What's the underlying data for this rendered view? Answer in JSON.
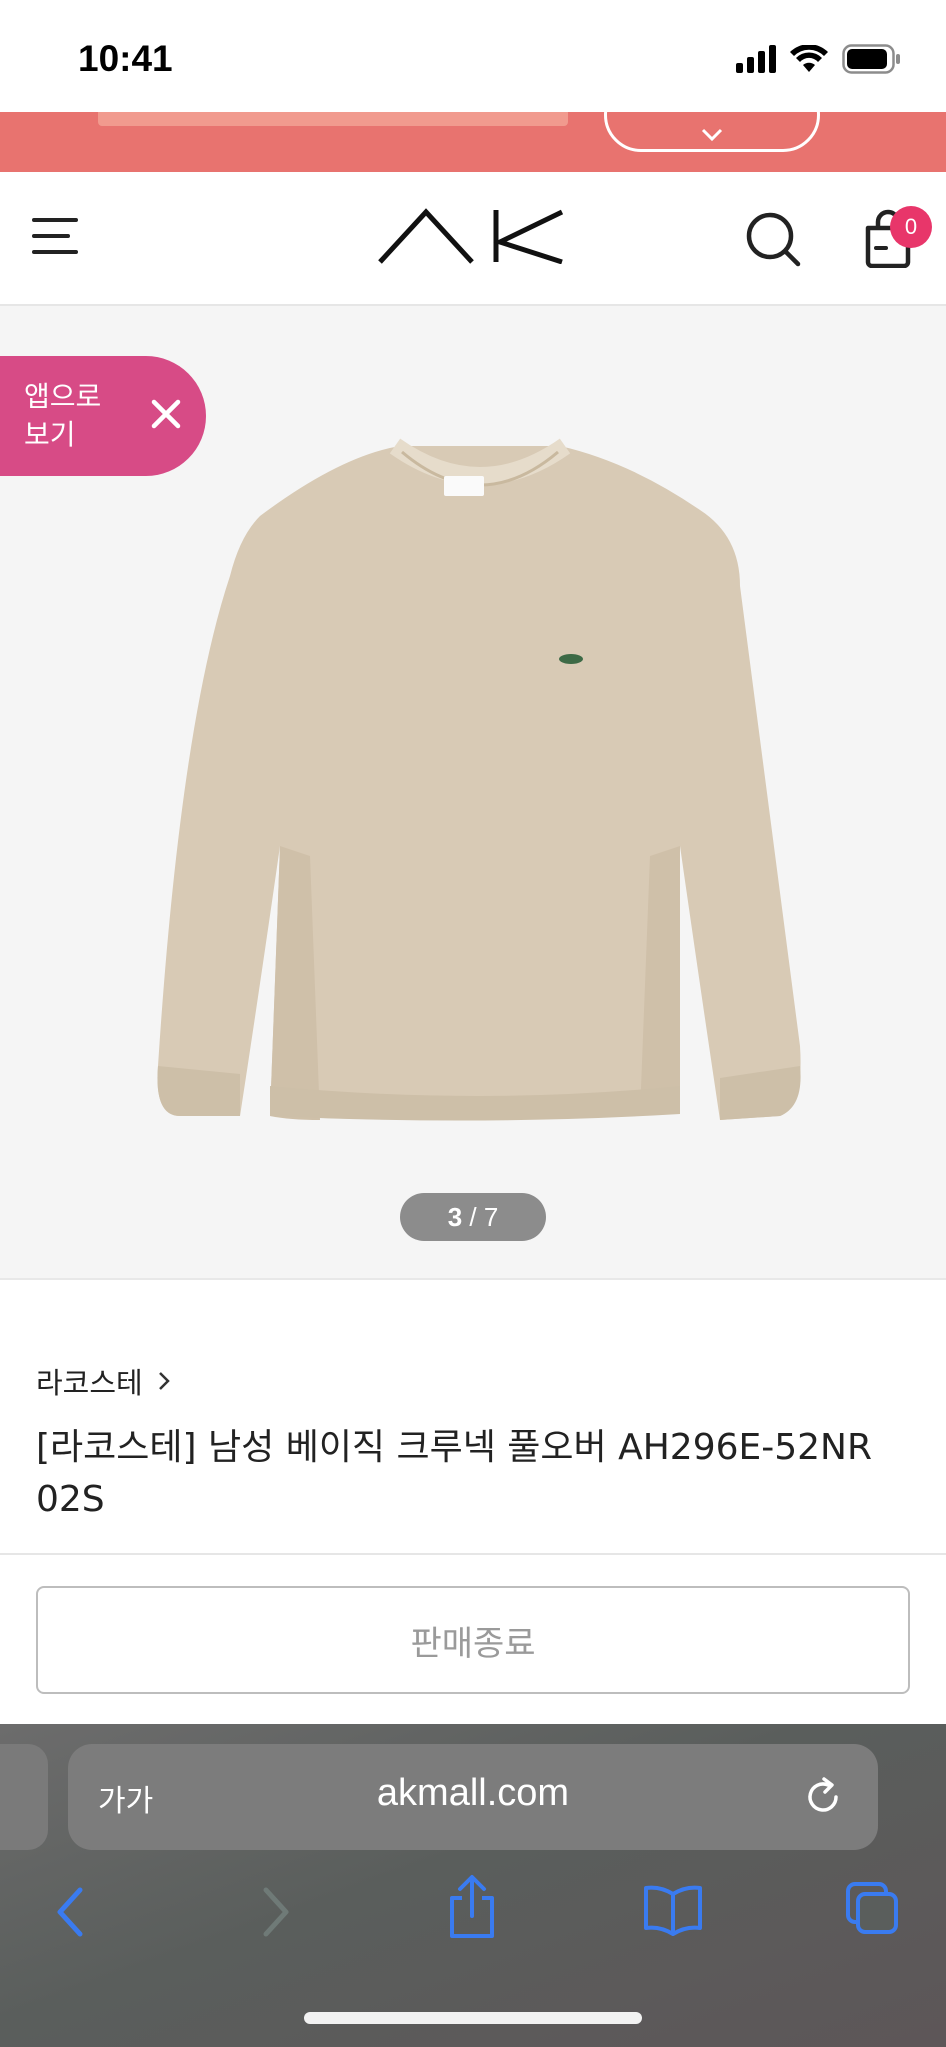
{
  "status_bar": {
    "time": "10:41"
  },
  "promo": {
    "pill_label": ""
  },
  "header": {
    "logo_text": "AK",
    "cart_count": "0"
  },
  "app_prompt": {
    "label": "앱으로 보기"
  },
  "gallery": {
    "current": "3",
    "total": "7",
    "separator": " / "
  },
  "product": {
    "brand": "라코스테",
    "title": "[라코스테] 남성 베이직 크루넥 풀오버 AH296E-52NR 02S",
    "status_button": "판매종료"
  },
  "browser": {
    "text_size_label": "가가",
    "url": "akmall.com"
  },
  "colors": {
    "banner": "#e8736f",
    "app_pill": "#d74b86",
    "cart_badge": "#e8366a",
    "safari_icons": "#3a7bf0"
  }
}
